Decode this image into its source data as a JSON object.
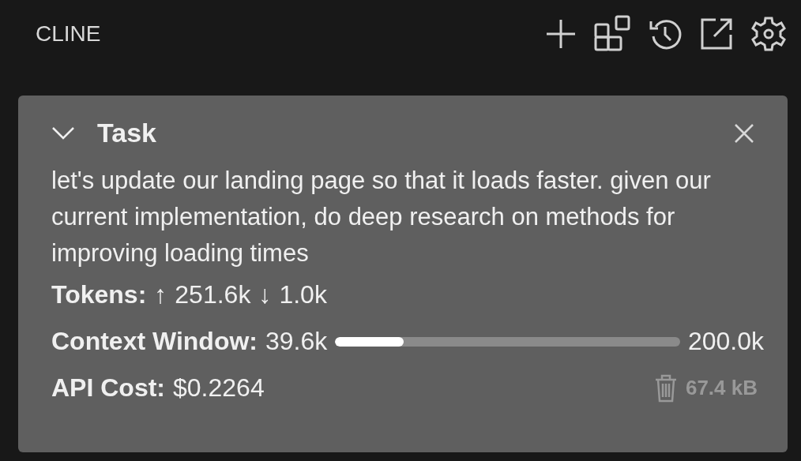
{
  "header": {
    "title": "CLINE"
  },
  "task": {
    "title": "Task",
    "expanded": true,
    "text": "let's update our landing page so that it loads faster. given our current implementation, do deep research on methods for improving loading times",
    "tokens": {
      "label": "Tokens:",
      "up_arrow": "↑",
      "up": "251.6k",
      "down_arrow": "↓",
      "down": "1.0k"
    },
    "context_window": {
      "label": "Context Window:",
      "used": "39.6k",
      "level": 0.198,
      "max": "200.0k"
    },
    "api_cost": {
      "label": "API Cost:",
      "value": "$0.2264"
    },
    "size": "67.4 kB"
  }
}
